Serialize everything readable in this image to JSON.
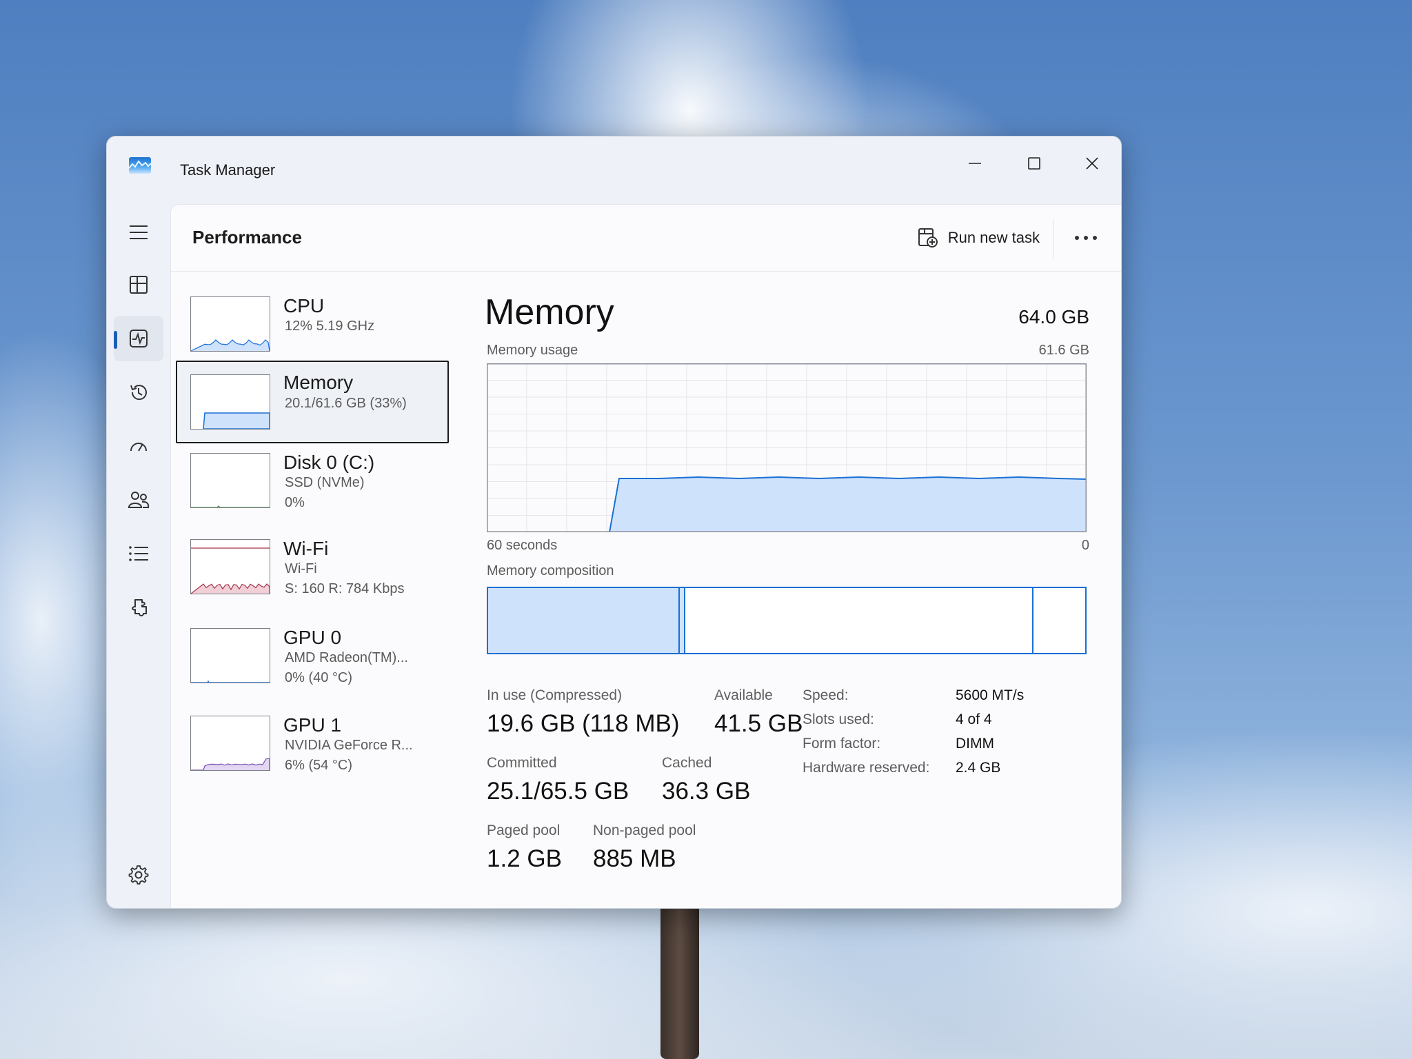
{
  "window": {
    "title": "Task Manager"
  },
  "header": {
    "page_title": "Performance",
    "run_new_task": "Run new task"
  },
  "resources": [
    {
      "name": "CPU",
      "line1": "12%  5.19 GHz",
      "line2": ""
    },
    {
      "name": "Memory",
      "line1": "20.1/61.6 GB (33%)",
      "line2": ""
    },
    {
      "name": "Disk 0 (C:)",
      "line1": "SSD (NVMe)",
      "line2": "0%"
    },
    {
      "name": "Wi-Fi",
      "line1": "Wi-Fi",
      "line2": "S: 160  R: 784 Kbps"
    },
    {
      "name": "GPU 0",
      "line1": "AMD Radeon(TM)...",
      "line2": "0%  (40 °C)"
    },
    {
      "name": "GPU 1",
      "line1": "NVIDIA GeForce R...",
      "line2": "6%  (54 °C)"
    }
  ],
  "memory": {
    "title": "Memory",
    "total": "64.0 GB",
    "usage_label": "Memory usage",
    "usage_max": "61.6 GB",
    "time_left": "60 seconds",
    "time_right": "0",
    "composition_label": "Memory composition",
    "stats": {
      "in_use_label": "In use (Compressed)",
      "in_use_value": "19.6 GB (118 MB)",
      "available_label": "Available",
      "available_value": "41.5 GB",
      "committed_label": "Committed",
      "committed_value": "25.1/65.5 GB",
      "cached_label": "Cached",
      "cached_value": "36.3 GB",
      "paged_pool_label": "Paged pool",
      "paged_pool_value": "1.2 GB",
      "nonpaged_pool_label": "Non-paged pool",
      "nonpaged_pool_value": "885 MB"
    },
    "specs": [
      {
        "key": "Speed:",
        "value": "5600 MT/s"
      },
      {
        "key": "Slots used:",
        "value": "4 of 4"
      },
      {
        "key": "Form factor:",
        "value": "DIMM"
      },
      {
        "key": "Hardware reserved:",
        "value": "2.4 GB"
      }
    ]
  },
  "colors": {
    "memory_line": "#1a6fd4",
    "memory_fill": "#cfe2fb",
    "wifi_line": "#a3324a",
    "gpu1_line": "#7a4fb3",
    "accent": "#1a5fb4"
  }
}
